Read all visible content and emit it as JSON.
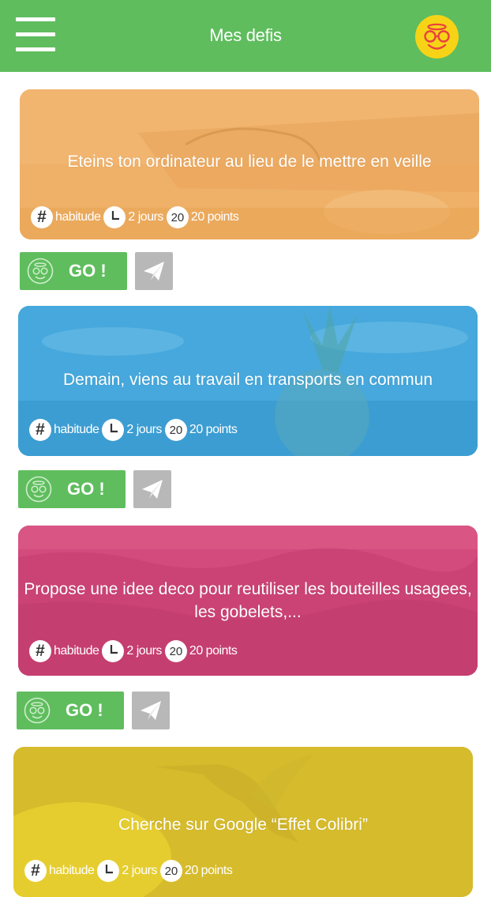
{
  "header": {
    "title": "Mes defis",
    "menu_icon": "hamburger-menu-icon",
    "avatar_icon": "smiley-halo-glasses-icon"
  },
  "colors": {
    "header": "#5fbd5e",
    "go_button": "#5fbd5e",
    "share_button": "#b8b8b8",
    "card1": "#eeaa5c",
    "card2": "#3fa3d9",
    "card3": "#d4477c",
    "card4": "#d9be2a"
  },
  "challenges": [
    {
      "title": "Eteins ton ordinateur au lieu de le mettre en veille",
      "tag_icon": "#",
      "tag": "habitude",
      "duration": "2 jours",
      "points_badge": "20",
      "points": "20 points",
      "go_label": "GO !"
    },
    {
      "title": "Demain, viens au travail en transports en commun",
      "tag_icon": "#",
      "tag": "habitude",
      "duration": "2 jours",
      "points_badge": "20",
      "points": "20 points",
      "go_label": "GO !"
    },
    {
      "title": "Propose une idee deco pour reutiliser les bouteilles usagees, les gobelets,...",
      "tag_icon": "#",
      "tag": "habitude",
      "duration": "2 jours",
      "points_badge": "20",
      "points": "20 points",
      "go_label": "GO !"
    },
    {
      "title": "Cherche sur Google “Effet Colibri”",
      "tag_icon": "#",
      "tag": "habitude",
      "duration": "2 jours",
      "points_badge": "20",
      "points": "20 points"
    }
  ]
}
